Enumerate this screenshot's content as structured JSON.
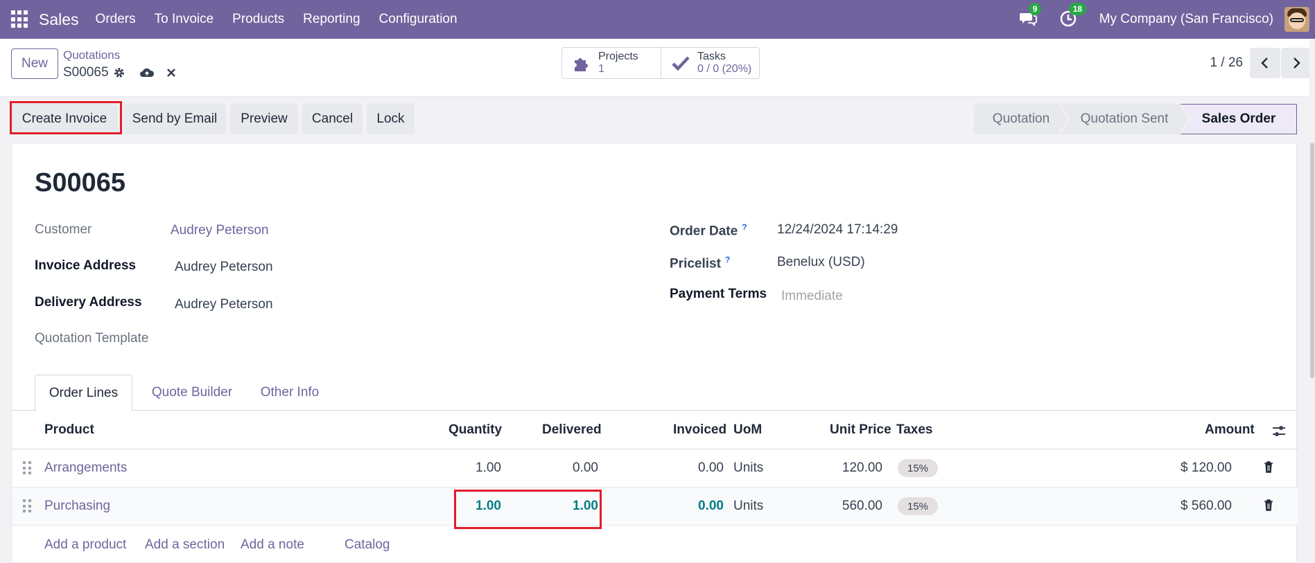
{
  "nav": {
    "app_name": "Sales",
    "menu": [
      "Orders",
      "To Invoice",
      "Products",
      "Reporting",
      "Configuration"
    ],
    "chat_badge": "9",
    "activity_badge": "18",
    "company": "My Company (San Francisco)"
  },
  "control": {
    "new_label": "New",
    "breadcrumb": "Quotations",
    "record": "S00065",
    "smart_buttons": [
      {
        "label": "Projects",
        "value": "1",
        "icon": "puzzle-icon"
      },
      {
        "label": "Tasks",
        "value": "0 / 0 (20%)",
        "icon": "check-icon"
      }
    ],
    "pager": "1 / 26"
  },
  "actions": [
    "Create Invoice",
    "Send by Email",
    "Preview",
    "Cancel",
    "Lock"
  ],
  "stages": [
    "Quotation",
    "Quotation Sent",
    "Sales Order"
  ],
  "active_stage": "Sales Order",
  "form": {
    "title": "S00065",
    "customer_label": "Customer",
    "customer": "Audrey Peterson",
    "invoice_address_label": "Invoice Address",
    "invoice_address": "Audrey Peterson",
    "delivery_address_label": "Delivery Address",
    "delivery_address": "Audrey Peterson",
    "template_label": "Quotation Template",
    "order_date_label": "Order Date",
    "order_date": "12/24/2024 17:14:29",
    "pricelist_label": "Pricelist",
    "pricelist": "Benelux (USD)",
    "payment_terms_label": "Payment Terms",
    "payment_terms_placeholder": "Immediate",
    "help_mark": "?"
  },
  "tabs": [
    "Order Lines",
    "Quote Builder",
    "Other Info"
  ],
  "table": {
    "columns": [
      "Product",
      "Quantity",
      "Delivered",
      "Invoiced",
      "UoM",
      "Unit Price",
      "Taxes",
      "Amount"
    ],
    "rows": [
      {
        "product": "Arrangements",
        "quantity": "1.00",
        "delivered": "0.00",
        "invoiced": "0.00",
        "uom": "Units",
        "unit_price": "120.00",
        "taxes": "15%",
        "amount": "$ 120.00"
      },
      {
        "product": "Purchasing",
        "quantity": "1.00",
        "delivered": "1.00",
        "invoiced": "0.00",
        "uom": "Units",
        "unit_price": "560.00",
        "taxes": "15%",
        "amount": "$ 560.00"
      }
    ],
    "add_links": [
      "Add a product",
      "Add a section",
      "Add a note",
      "Catalog"
    ]
  },
  "colors": {
    "brand": "#71639e",
    "highlight": "#e11d2a",
    "teal": "#017e84"
  }
}
